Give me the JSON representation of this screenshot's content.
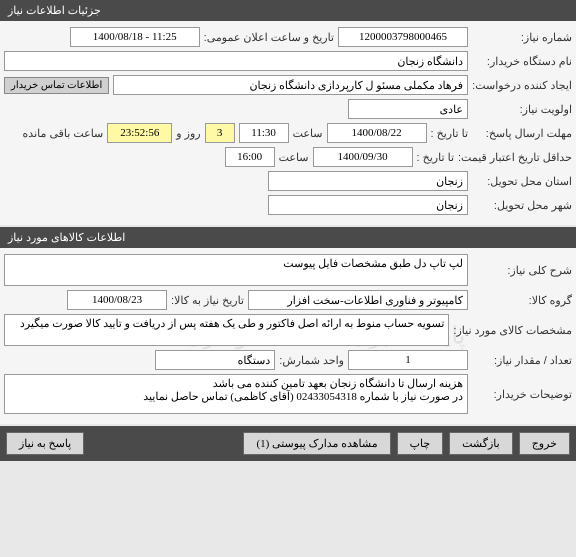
{
  "panels": {
    "info": {
      "title": "جزئیات اطلاعات نیاز"
    },
    "goods": {
      "title": "اطلاعات کالاهای مورد نیاز"
    }
  },
  "labels": {
    "need_number": "شماره نیاز:",
    "announce_datetime": "تاریخ و ساعت اعلان عمومی:",
    "buyer_name": "نام دستگاه خریدار:",
    "request_creator": "ایجاد کننده درخواست:",
    "buyer_contact_btn": "اطلاعات تماس خریدار",
    "priority": "اولویت نیاز:",
    "response_deadline": "مهلت ارسال پاسخ:",
    "to_date": "تا تاریخ :",
    "to_date2": "تا تاریخ :",
    "time": "ساعت",
    "days_and": "روز و",
    "hours_remaining": "ساعت باقی مانده",
    "price_validity": "حداقل تاریخ اعتبار قیمت:",
    "delivery_province": "استان محل تحویل:",
    "delivery_city": "شهر محل تحویل:",
    "need_summary": "شرح کلی نیاز:",
    "goods_group": "گروه کالا:",
    "need_date": "تاریخ نیاز به کالا:",
    "goods_spec": "مشخصات کالای مورد نیاز:",
    "qty": "تعداد / مقدار نیاز:",
    "unit": "واحد شمارش:",
    "buyer_notes": "توضیحات خریدار:"
  },
  "values": {
    "need_number": "1200003798000465",
    "announce_datetime": "1400/08/18 - 11:25",
    "buyer_name": "دانشگاه زنجان",
    "request_creator": "فرهاد مکملی مسئو ل کارپردازی دانشگاه زنجان",
    "priority": "عادی",
    "deadline_date": "1400/08/22",
    "deadline_time": "11:30",
    "days_remaining": "3",
    "time_remaining": "23:52:56",
    "validity_date": "1400/09/30",
    "validity_time": "16:00",
    "province": "زنجان",
    "city": "زنجان",
    "need_summary": "لپ تاپ دل طبق مشخصات فایل پیوست",
    "goods_group": "کامپیوتر و فناوری اطلاعات-سخت افزار",
    "need_date": "1400/08/23",
    "goods_spec": "تسویه حساب منوط به ارائه اصل فاکتور و طی یک هفته پس از دریافت و تایید کالا صورت میگیرد",
    "qty": "1",
    "unit": "دستگاه",
    "buyer_notes": "هزینه ارسال تا دانشگاه زنجان بعهد تامین کننده می باشد\nدر صورت نیاز با شماره 02433054318 (آقای کاظمی) تماس حاصل نمایید"
  },
  "footer": {
    "respond": "پاسخ به نیاز",
    "attachments": "مشاهده مدارک پیوستی (1)",
    "print": "چاپ",
    "back": "بازگشت",
    "exit": "خروج"
  },
  "watermark": "پایگاه خبری مناقصات و مزایدات ماد"
}
